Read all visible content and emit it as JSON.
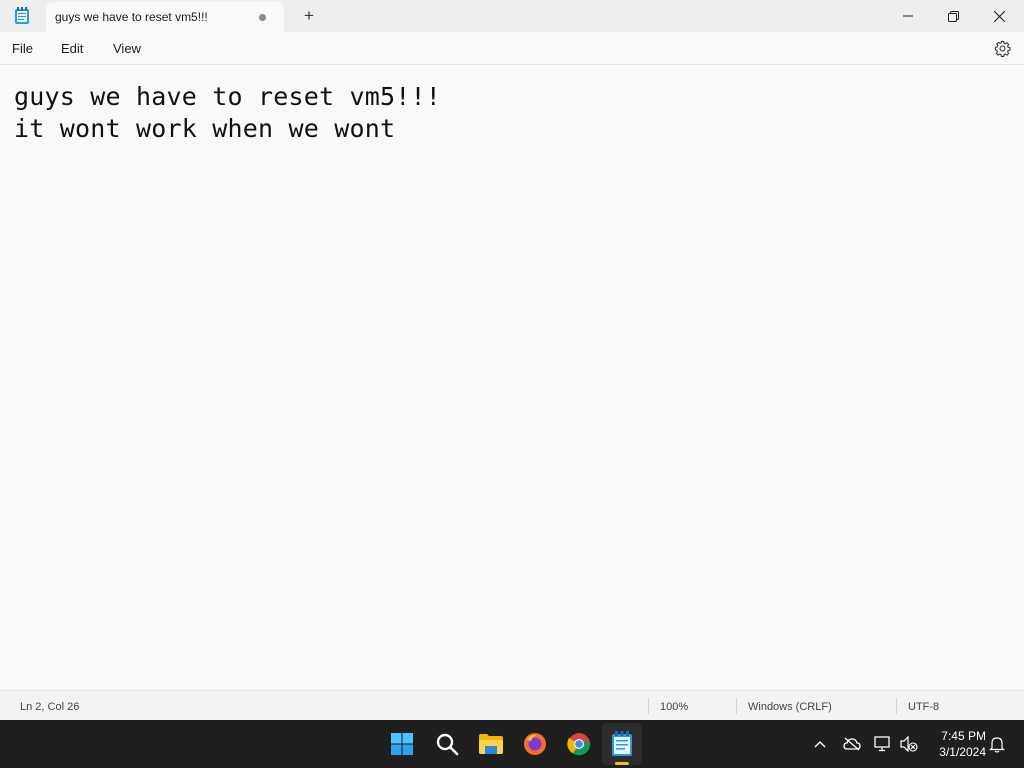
{
  "tab": {
    "title": "guys we have to reset vm5!!!",
    "new_tab_label": "+"
  },
  "menu": {
    "file": "File",
    "edit": "Edit",
    "view": "View"
  },
  "editor": {
    "lines": [
      "guys we have to reset vm5!!!",
      "it wont work when we wont"
    ]
  },
  "status": {
    "position": "Ln 2, Col 26",
    "zoom": "100%",
    "line_ending": "Windows (CRLF)",
    "encoding": "UTF-8"
  },
  "taskbar": {
    "apps": [
      "start-icon",
      "search-icon",
      "file-explorer-icon",
      "firefox-icon",
      "chrome-icon",
      "notepad-icon"
    ],
    "active_app": "notepad"
  },
  "clock": {
    "time": "7:45 PM",
    "date": "3/1/2024"
  },
  "colors": {
    "accent": "#f0c020",
    "taskbar_bg": "#1f1f1f",
    "window_bg": "#f9f9f9"
  }
}
